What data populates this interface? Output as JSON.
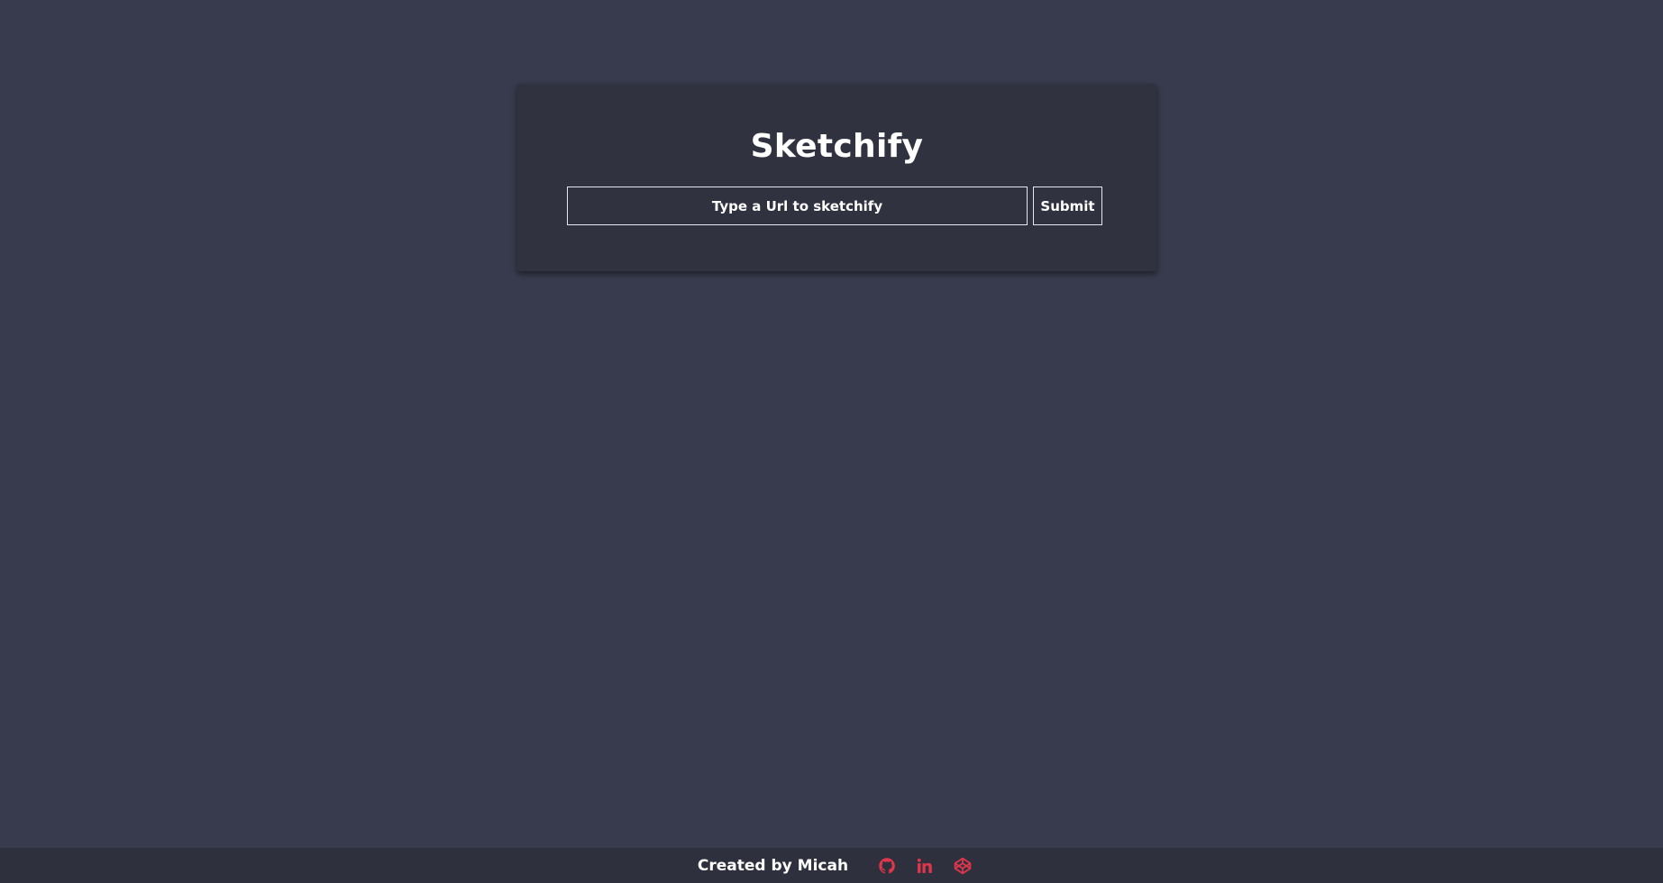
{
  "app": {
    "title": "Sketchify"
  },
  "form": {
    "url_placeholder": "Type a Url to sketchify",
    "url_value": "",
    "submit_label": "Submit"
  },
  "footer": {
    "credit": "Created by Micah",
    "links": [
      {
        "icon": "github-icon"
      },
      {
        "icon": "linkedin-icon"
      },
      {
        "icon": "codepen-icon"
      }
    ]
  },
  "colors": {
    "background": "#383a4d",
    "card": "#313240",
    "footer": "#2f303d",
    "accent": "#e0364b",
    "text": "#ffffff"
  }
}
